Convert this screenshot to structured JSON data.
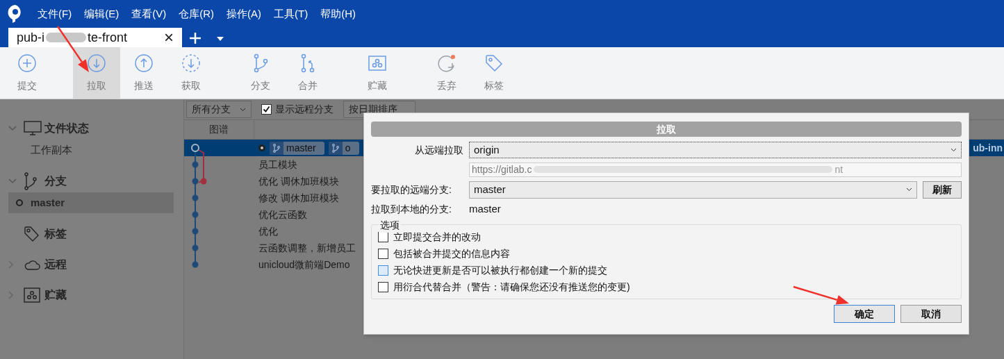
{
  "menu": [
    "文件(F)",
    "编辑(E)",
    "查看(V)",
    "仓库(R)",
    "操作(A)",
    "工具(T)",
    "帮助(H)"
  ],
  "tab": {
    "title_start": "pub-i",
    "title_end": "te-front",
    "selected": true,
    "close": "×"
  },
  "toolbar": {
    "groups": [
      [
        {
          "kind": "commit",
          "label": "提交",
          "selected": false
        }
      ],
      [
        {
          "kind": "pull",
          "label": "拉取",
          "selected": true
        },
        {
          "kind": "push",
          "label": "推送",
          "selected": false
        },
        {
          "kind": "fetch",
          "label": "获取",
          "selected": false
        }
      ],
      [
        {
          "kind": "branch",
          "label": "分支",
          "selected": false
        },
        {
          "kind": "merge",
          "label": "合并",
          "selected": false
        }
      ],
      [
        {
          "kind": "stash",
          "label": "贮藏",
          "selected": false
        }
      ],
      [
        {
          "kind": "discard",
          "label": "丢弃",
          "selected": false
        },
        {
          "kind": "tag",
          "label": "标签",
          "selected": false
        }
      ]
    ]
  },
  "sidebar": {
    "sections": [
      {
        "kind": "monitor",
        "label": "文件状态",
        "expanded": true,
        "children": [
          {
            "label": "工作副本",
            "selected": false,
            "current": false
          }
        ]
      },
      {
        "kind": "branch",
        "label": "分支",
        "expanded": true,
        "children": [
          {
            "label": "master",
            "selected": true,
            "current": true
          }
        ]
      },
      {
        "kind": "tag",
        "label": "标签"
      },
      {
        "kind": "cloud",
        "label": "远程",
        "expanded": false
      },
      {
        "kind": "stash",
        "label": "贮藏",
        "expanded": false
      }
    ]
  },
  "filters": {
    "branches": "所有分支",
    "show_remote": {
      "label": "显示远程分支",
      "checked": true
    },
    "sort": "按日期排序"
  },
  "graph_header": "图谱",
  "commits": [
    {
      "selected": true,
      "badges": [
        "master",
        "o"
      ],
      "right_text": "ub-inn"
    },
    {
      "message": "员工模块",
      "selected": false
    },
    {
      "message": "优化 调休加班模块",
      "selected": false
    },
    {
      "message": "修改 调休加班模块",
      "selected": false
    },
    {
      "message": "优化云函数",
      "selected": false
    },
    {
      "message": "优化",
      "selected": false
    },
    {
      "message": "云函数调整，新增员工",
      "selected": false
    },
    {
      "message": "unicloud微前端Demo",
      "selected": false
    }
  ],
  "dialog": {
    "title": "拉取",
    "remote_label": "从远端拉取",
    "remote": "origin",
    "url_start": "https://gitlab.c",
    "url_end": "nt",
    "branch_label": "要拉取的远端分支:",
    "branch": "master",
    "refresh": "刷新",
    "local_label": "拉取到本地的分支:",
    "local": "master",
    "options_title": "选项",
    "options": [
      {
        "label": "立即提交合并的改动",
        "checked": false,
        "focused": false
      },
      {
        "label": "包括被合并提交的信息内容",
        "checked": false,
        "focused": false
      },
      {
        "label": "无论快进更新是否可以被执行都创建一个新的提交",
        "checked": false,
        "focused": true
      },
      {
        "label": "用衍合代替合并（警告：请确保您还没有推送您的变更)",
        "checked": false,
        "focused": false
      }
    ],
    "buttons": [
      {
        "label": "确定",
        "default": true
      },
      {
        "label": "取消",
        "default": false
      }
    ]
  }
}
